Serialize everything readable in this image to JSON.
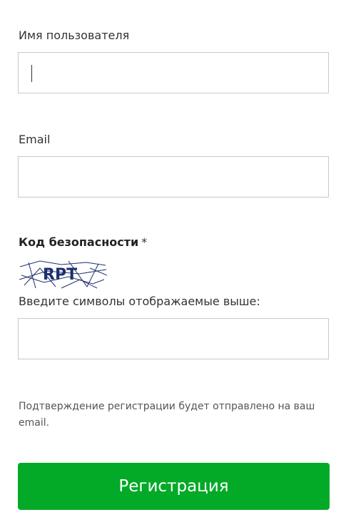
{
  "username": {
    "label": "Имя пользователя",
    "value": ""
  },
  "email": {
    "label": "Email",
    "value": ""
  },
  "security": {
    "label": "Код безопасности",
    "required_mark": "*",
    "captcha_text": "RPT",
    "instruction": "Введите символы отображаемые выше:",
    "value": ""
  },
  "note": "Подтверждение регистрации будет отправлено на ваш email.",
  "submit_label": "Регистрация",
  "colors": {
    "button": "#02aa27",
    "border": "#c8c8c8",
    "captcha_ink": "#1f2f6e"
  }
}
